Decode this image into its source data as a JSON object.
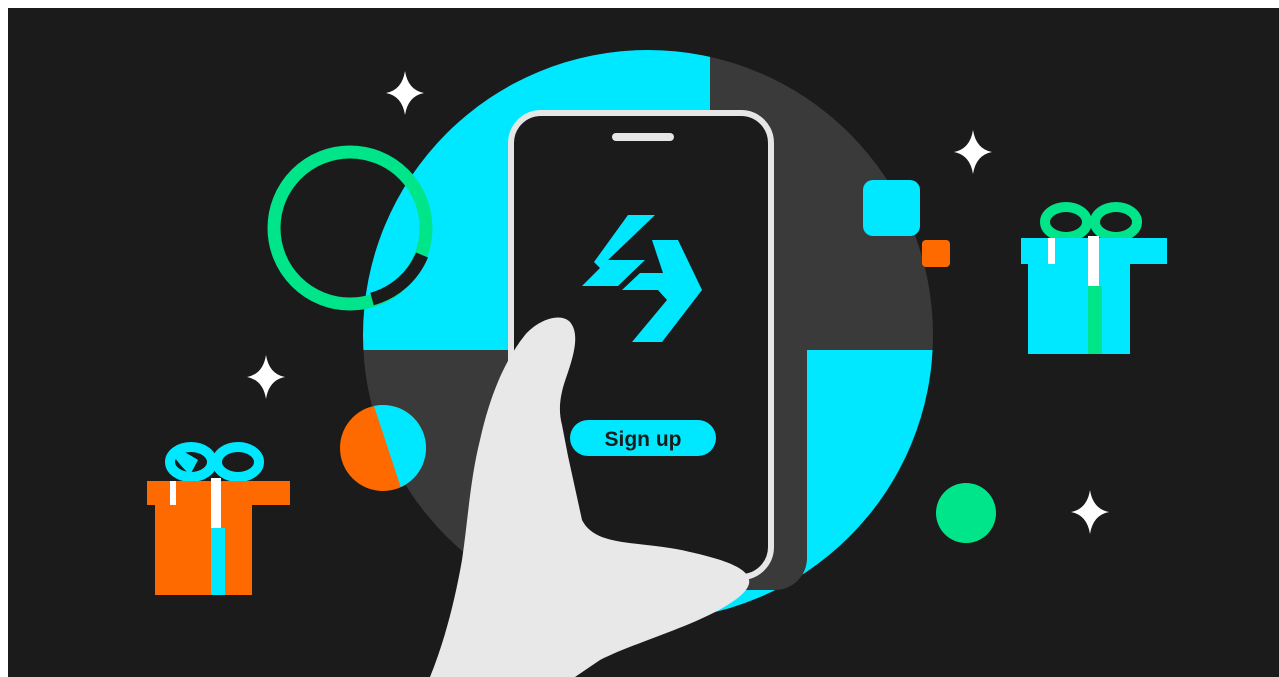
{
  "signup": {
    "label": "Sign up"
  },
  "colors": {
    "background": "#1b1b1b",
    "cyan": "#00e8ff",
    "green": "#00e58a",
    "orange": "#ff6a00",
    "dark_gray": "#3a3a3a",
    "phone_screen": "#1b1b1b",
    "phone_frame": "#e6e6e6",
    "hand": "#e8e8e8",
    "white": "#ffffff"
  },
  "icons": [
    "sparkle-icon",
    "gift-icon",
    "logo-icon",
    "ring-icon"
  ]
}
